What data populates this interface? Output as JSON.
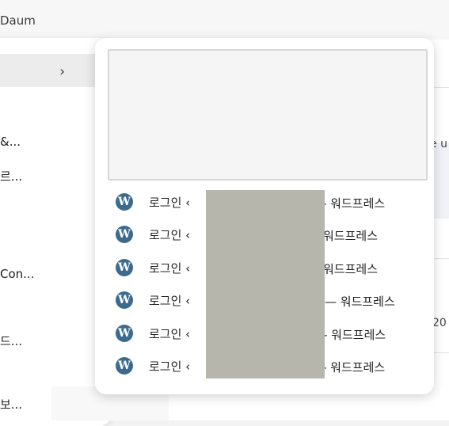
{
  "bookmarks_bar": {
    "daum_label": "Daum"
  },
  "background_page": {
    "fragment_1": "e u",
    "fragment_2": "20"
  },
  "parent_menu": {
    "chevron": "›",
    "items": [
      "&...",
      "르...",
      "Con...",
      "드...",
      "보..."
    ]
  },
  "submenu": {
    "items": [
      {
        "label": "로그인 ‹",
        "suffix": "- 워드프레스"
      },
      {
        "label": "로그인 ‹",
        "suffix": "워드프레스"
      },
      {
        "label": "로그인 ‹",
        "suffix": "워드프레스"
      },
      {
        "label": "로그인 ‹",
        "suffix": "— 워드프레스"
      },
      {
        "label": "로그인 ‹",
        "suffix": "- 워드프레스"
      },
      {
        "label": "로그인 ‹",
        "suffix": "- 워드프레스"
      }
    ],
    "item_icon": "wordpress-icon",
    "icon_glyph": "W"
  },
  "colors": {
    "wp_blue": "#3c6b8e",
    "redaction": "#b6b6ad"
  }
}
